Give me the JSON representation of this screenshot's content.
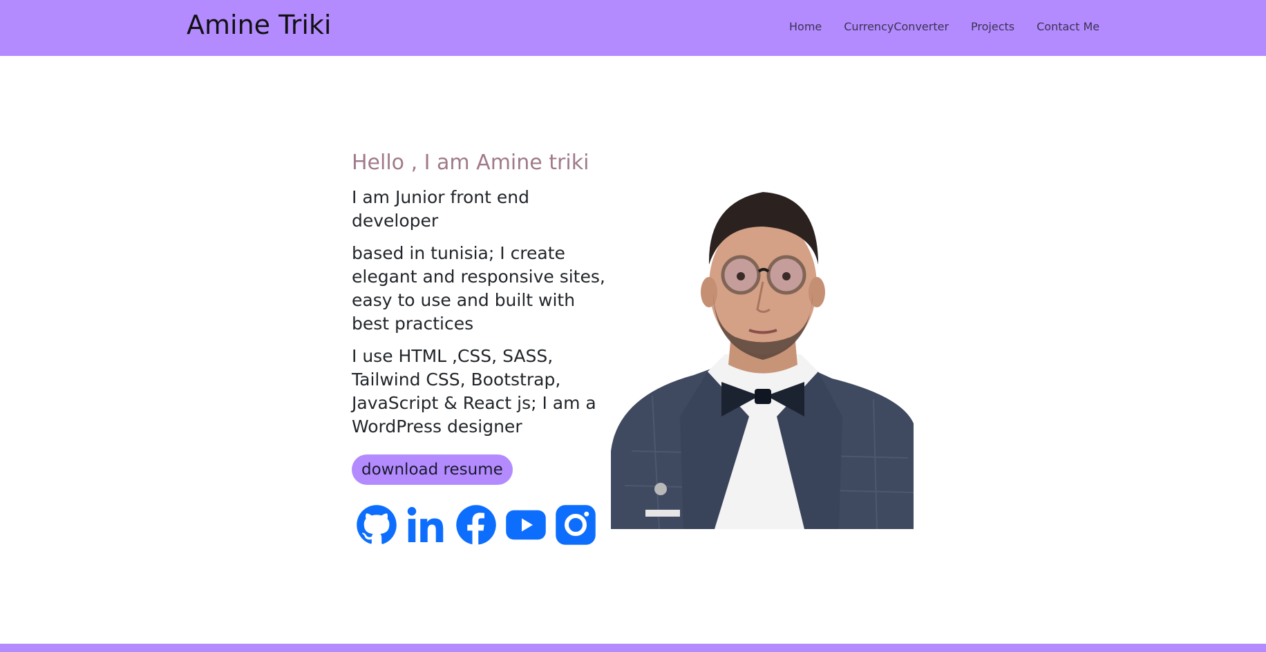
{
  "navbar": {
    "brand": "Amine Triki",
    "links": [
      {
        "label": "Home"
      },
      {
        "label": "CurrencyConverter"
      },
      {
        "label": "Projects"
      },
      {
        "label": "Contact Me"
      }
    ]
  },
  "hero": {
    "greeting": "Hello , I am Amine triki",
    "role": "I am Junior front end developer",
    "description": "based in tunisia; I create elegant and responsive sites, easy to use and built with best practices",
    "skills": "I use HTML ,CSS, SASS, Tailwind CSS, Bootstrap, JavaScript & React js; I am a WordPress designer",
    "resume_button": "download resume"
  },
  "socials": [
    {
      "icon": "github-icon"
    },
    {
      "icon": "linkedin-icon"
    },
    {
      "icon": "facebook-icon"
    },
    {
      "icon": "youtube-icon"
    },
    {
      "icon": "instagram-icon"
    }
  ],
  "colors": {
    "accent": "#b38bff",
    "greeting": "#a07a8a",
    "social_icon": "#0d6efd"
  }
}
